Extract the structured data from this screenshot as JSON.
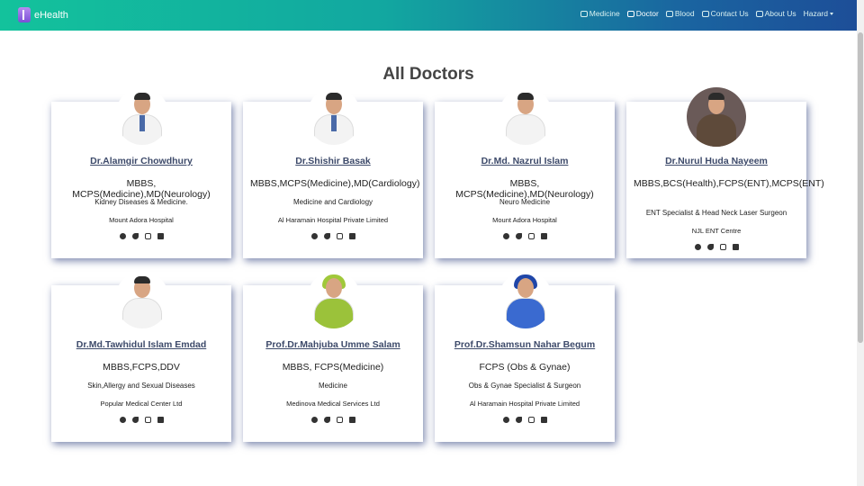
{
  "brand": {
    "name": "eHealth"
  },
  "nav": {
    "items": [
      {
        "label": "Medicine",
        "icon": "capsule-icon"
      },
      {
        "label": "Doctor",
        "icon": "stethoscope-icon"
      },
      {
        "label": "Blood",
        "icon": "blood-drop-icon"
      },
      {
        "label": "Contact Us",
        "icon": "bank-icon"
      },
      {
        "label": "About Us",
        "icon": "document-icon"
      }
    ],
    "user_menu": "Hazard"
  },
  "page": {
    "title": "All Doctors"
  },
  "doctors": [
    {
      "name": "Dr.Alamgir Chowdhury",
      "degree": "MBBS, MCPS(Medicine),MD(Neurology)",
      "specialty": "Kidney Diseases & Medicine.",
      "hospital": "Mount Adora Hospital"
    },
    {
      "name": "Dr.Shishir Basak",
      "degree": "MBBS,MCPS(Medicine),MD(Cardiology)",
      "specialty": "Medicine and Cardiology",
      "hospital": "Al Haramain Hospital Private Limited"
    },
    {
      "name": "Dr.Md. Nazrul Islam",
      "degree": "MBBS, MCPS(Medicine),MD(Neurology)",
      "specialty": "Neuro Medicine",
      "hospital": "Mount Adora Hospital"
    },
    {
      "name": "Dr.Nurul Huda Nayeem",
      "degree": "MBBS,BCS(Health),FCPS(ENT),MCPS(ENT)",
      "specialty": "ENT Specialist & Head Neck Laser Surgeon",
      "hospital": "NJL ENT Centre"
    },
    {
      "name": "Dr.Md.Tawhidul Islam Emdad",
      "degree": "MBBS,FCPS,DDV",
      "specialty": "Skin,Allergy and Sexual Diseases",
      "hospital": "Popular Medical Center Ltd"
    },
    {
      "name": "Prof.Dr.Mahjuba Umme Salam",
      "degree": "MBBS, FCPS(Medicine)",
      "specialty": "Medicine",
      "hospital": "Medinova Medical Services Ltd"
    },
    {
      "name": "Prof.Dr.Shamsun Nahar Begum",
      "degree": "FCPS (Obs & Gynae)",
      "specialty": "Obs & Gynae Specialist & Surgeon",
      "hospital": "Al Haramain Hospital Private Limited"
    }
  ],
  "social_icons": [
    "facebook-icon",
    "twitter-icon",
    "instagram-icon",
    "linkedin-icon"
  ],
  "colors": {
    "nav_start": "#13c29c",
    "nav_end": "#1d4e98",
    "name_text": "#3d4a6a"
  }
}
